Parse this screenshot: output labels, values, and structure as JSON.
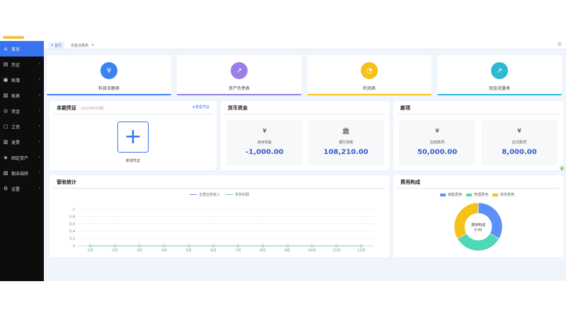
{
  "sidebar": {
    "items": [
      {
        "label": "首页",
        "icon": "home-icon",
        "glyph": "⌂"
      },
      {
        "label": "凭证",
        "icon": "voucher-icon",
        "glyph": "▤"
      },
      {
        "label": "账簿",
        "icon": "ledger-icon",
        "glyph": "▣"
      },
      {
        "label": "账表",
        "icon": "report-icon",
        "glyph": "▨"
      },
      {
        "label": "资金",
        "icon": "fund-icon",
        "glyph": "◎"
      },
      {
        "label": "工资",
        "icon": "salary-icon",
        "glyph": "▢"
      },
      {
        "label": "发票",
        "icon": "invoice-icon",
        "glyph": "▥"
      },
      {
        "label": "固定资产",
        "icon": "asset-icon",
        "glyph": "◈"
      },
      {
        "label": "期末结转",
        "icon": "closing-icon",
        "glyph": "▧"
      },
      {
        "label": "设置",
        "icon": "gear-icon",
        "glyph": "⚙"
      }
    ]
  },
  "tabs": {
    "home": "首页",
    "cash": "现金流量表",
    "close_glyph": "×"
  },
  "reports": [
    {
      "label": "科目余额表",
      "color": "#3b82f6",
      "glyph": "¥"
    },
    {
      "label": "资产负债表",
      "color": "#9b7ee6",
      "glyph": "↗"
    },
    {
      "label": "利润表",
      "color": "#f5c218",
      "glyph": "◔"
    },
    {
      "label": "现金流量表",
      "color": "#2fb8d3",
      "glyph": "↗"
    }
  ],
  "voucher": {
    "title": "本期凭证",
    "period": "(2024年05期)",
    "link": "查看凭证",
    "add_label": "新增凭证",
    "add_glyph": "+"
  },
  "money": {
    "title": "货币资金",
    "items": [
      {
        "label": "库存现金",
        "value": "-1,000.00",
        "glyph": "¥"
      },
      {
        "label": "银行存款",
        "value": "108,210.00",
        "glyph": "🏛"
      }
    ]
  },
  "accounts": {
    "title": "款项",
    "items": [
      {
        "label": "应收款项",
        "value": "50,000.00",
        "glyph": "¥"
      },
      {
        "label": "应付款项",
        "value": "8,000.00",
        "glyph": "¥"
      }
    ]
  },
  "revenue": {
    "title": "营收统计",
    "legend": [
      "主营业务收入",
      "本年利润"
    ]
  },
  "expense": {
    "title": "费用构成",
    "center_label": "费用构成",
    "center_value": "0.00"
  },
  "chart_data": [
    {
      "type": "line",
      "title": "营收统计",
      "categories": [
        "1月",
        "2月",
        "3月",
        "4月",
        "5月",
        "6月",
        "7月",
        "8月",
        "9月",
        "10月",
        "11月",
        "12月"
      ],
      "series": [
        {
          "name": "主营业务收入",
          "values": [
            0,
            0,
            0,
            0,
            0,
            0,
            0,
            0,
            0,
            0,
            0,
            0
          ],
          "color": "#5b8ff9"
        },
        {
          "name": "本年利润",
          "values": [
            0,
            0,
            0,
            0,
            0,
            0,
            0,
            0,
            0,
            0,
            0,
            0
          ],
          "color": "#5ad8a6"
        }
      ],
      "yticks": [
        "0",
        "0.2",
        "0.4",
        "0.6",
        "0.8",
        "1"
      ],
      "ylim": [
        0,
        1
      ],
      "grid": true,
      "legend": "top-center"
    },
    {
      "type": "pie",
      "title": "费用构成",
      "labels": [
        "销售费用",
        "管理费用",
        "财务费用"
      ],
      "values": [
        33.3,
        33.3,
        33.4
      ],
      "colors": [
        "#5b8ff9",
        "#4fd8b6",
        "#f5c218"
      ],
      "legend": "top-center"
    }
  ]
}
